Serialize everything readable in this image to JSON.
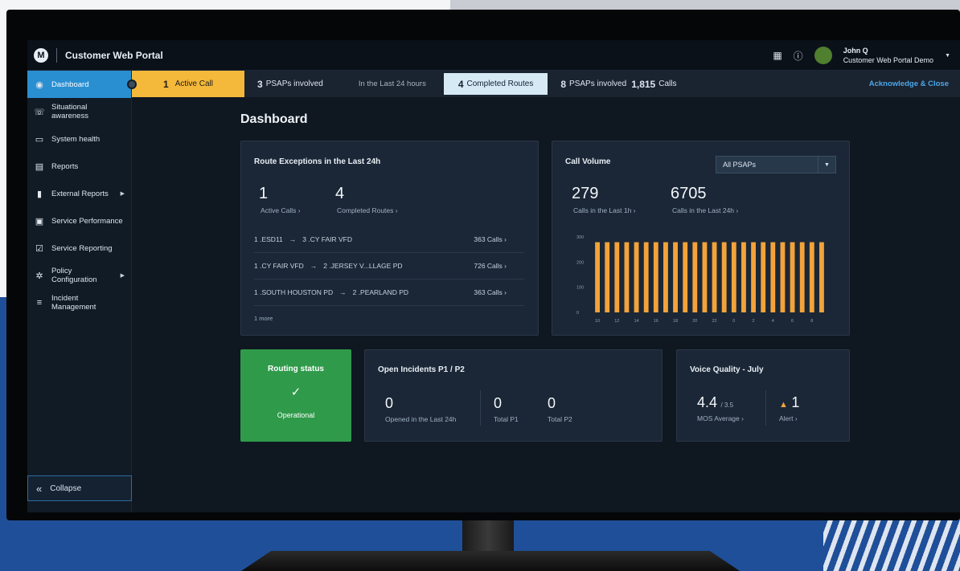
{
  "app": {
    "title": "Customer Web Portal",
    "logo_icon": "motorola-logo"
  },
  "topbar": {
    "grid_icon": "grid-icon",
    "info_icon": "info-icon",
    "user_name": "John Q",
    "user_org": "Customer Web Portal Demo"
  },
  "sidebar": {
    "items": [
      {
        "label": "Dashboard",
        "icon": "dashboard-icon",
        "active": true
      },
      {
        "label": "Situational awareness",
        "icon": "phone-icon"
      },
      {
        "label": "System health",
        "icon": "monitor-icon"
      },
      {
        "label": "Reports",
        "icon": "reports-icon"
      },
      {
        "label": "External Reports",
        "icon": "bar-chart-icon",
        "has_submenu": true
      },
      {
        "label": "Service Performance",
        "icon": "performance-icon"
      },
      {
        "label": "Service Reporting",
        "icon": "checkbox-icon"
      },
      {
        "label": "Policy Configuration",
        "icon": "gear-icon",
        "has_submenu": true
      },
      {
        "label": "Incident Management",
        "icon": "list-icon"
      }
    ],
    "collapse_label": "Collapse"
  },
  "alertbar": {
    "active_num": "1",
    "active_label": "Active Call",
    "psaps_num": "3",
    "psaps_label": "PSAPs involved",
    "window_label": "In the Last 24 hours",
    "completed_num": "4",
    "completed_label": "Completed Routes",
    "psaps2_num": "8",
    "psaps2_label": "PSAPs involved",
    "calls_num": "1,815",
    "calls_label": "Calls",
    "ack_label": "Acknowledge & Close"
  },
  "page": {
    "title": "Dashboard"
  },
  "route_exceptions": {
    "title": "Route Exceptions in the Last 24h",
    "active_num": "1",
    "active_label": "Active Calls ›",
    "completed_num": "4",
    "completed_label": "Completed Routes ›",
    "rows": [
      {
        "from": "1 .ESD11",
        "to": "3 .CY FAIR VFD",
        "calls": "363 Calls ›"
      },
      {
        "from": "1 .CY FAIR VFD",
        "to": "2 .JERSEY V...LLAGE PD",
        "calls": "726 Calls ›"
      },
      {
        "from": "1 .SOUTH HOUSTON PD",
        "to": "2 .PEARLAND PD",
        "calls": "363 Calls ›"
      }
    ],
    "more_label": "1 more"
  },
  "call_volume": {
    "title": "Call Volume",
    "dropdown_value": "All PSAPs",
    "last1h_num": "279",
    "last1h_label": "Calls in the Last 1h ›",
    "last24h_num": "6705",
    "last24h_label": "Calls in the Last 24h ›"
  },
  "chart_data": {
    "type": "bar",
    "categories": [
      "10",
      "11",
      "12",
      "13",
      "14",
      "15",
      "16",
      "17",
      "18",
      "19",
      "20",
      "21",
      "22",
      "23",
      "0",
      "1",
      "2",
      "3",
      "4",
      "5",
      "6",
      "7",
      "8",
      "9"
    ],
    "tick_labels": [
      "10",
      "12",
      "14",
      "16",
      "18",
      "20",
      "22",
      "0",
      "2",
      "4",
      "6",
      "8"
    ],
    "values": [
      279,
      279,
      279,
      279,
      279,
      279,
      279,
      279,
      279,
      279,
      279,
      279,
      279,
      279,
      279,
      279,
      279,
      279,
      279,
      279,
      279,
      279,
      279,
      279
    ],
    "ylim": [
      0,
      300
    ],
    "yticks": [
      0,
      100,
      200,
      300
    ],
    "color": "#f2a33a",
    "grid": false
  },
  "routing_status": {
    "title": "Routing status",
    "check_icon": "check-icon",
    "status": "Operational",
    "color": "#2f9a4a"
  },
  "open_incidents": {
    "title": "Open Incidents P1 / P2",
    "opened_num": "0",
    "opened_label": "Opened in the Last 24h",
    "p1_num": "0",
    "p1_label": "Total P1",
    "p2_num": "0",
    "p2_label": "Total P2"
  },
  "voice_quality": {
    "title": "Voice Quality - July",
    "mos_num": "4.4",
    "mos_scale": "/ 3.5",
    "mos_label": "MOS Average ›",
    "alert_num": "1",
    "alert_label": "Alert ›",
    "alert_icon": "warning-icon"
  }
}
